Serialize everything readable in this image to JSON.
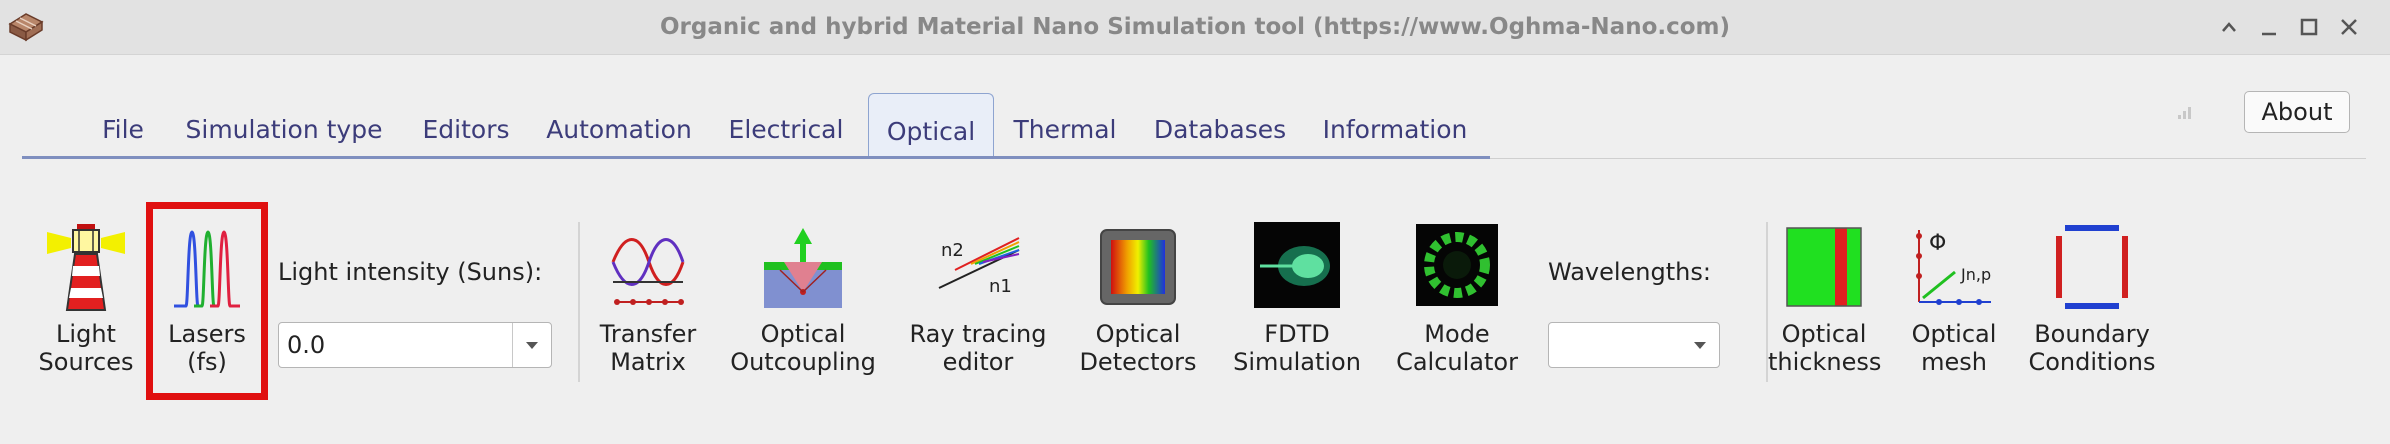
{
  "window": {
    "title": "Organic and hybrid Material Nano Simulation tool (https://www.Oghma-Nano.com)"
  },
  "menu_tabs": [
    "File",
    "Simulation type",
    "Editors",
    "Automation",
    "Electrical",
    "Optical",
    "Thermal",
    "Databases",
    "Information"
  ],
  "active_tab": "Optical",
  "about_label": "About",
  "ribbon": {
    "light_sources": "Light\nSources",
    "lasers": "Lasers\n(fs)",
    "light_intensity_label": "Light intensity (Suns):",
    "light_intensity_value": "0.0",
    "transfer_matrix": "Transfer\nMatrix",
    "optical_outcoupling": "Optical\nOutcoupling",
    "ray_tracing": "Ray tracing\neditor",
    "optical_detectors": "Optical\nDetectors",
    "fdtd": "FDTD\nSimulation",
    "mode_calculator": "Mode\nCalculator",
    "wavelengths_label": "Wavelengths:",
    "wavelengths_value": "",
    "optical_thickness": "Optical\nthickness",
    "optical_mesh": "Optical\nmesh",
    "boundary_conditions": "Boundary\nConditions"
  },
  "icon_text": {
    "ray_n2": "n2",
    "ray_n1": "n1",
    "mesh_phi": "Φ",
    "mesh_j": "Jn,p"
  },
  "colors": {
    "highlight": "#e01010",
    "tab_text": "#3c3c7a",
    "tab_underline": "#7f8fbf"
  }
}
